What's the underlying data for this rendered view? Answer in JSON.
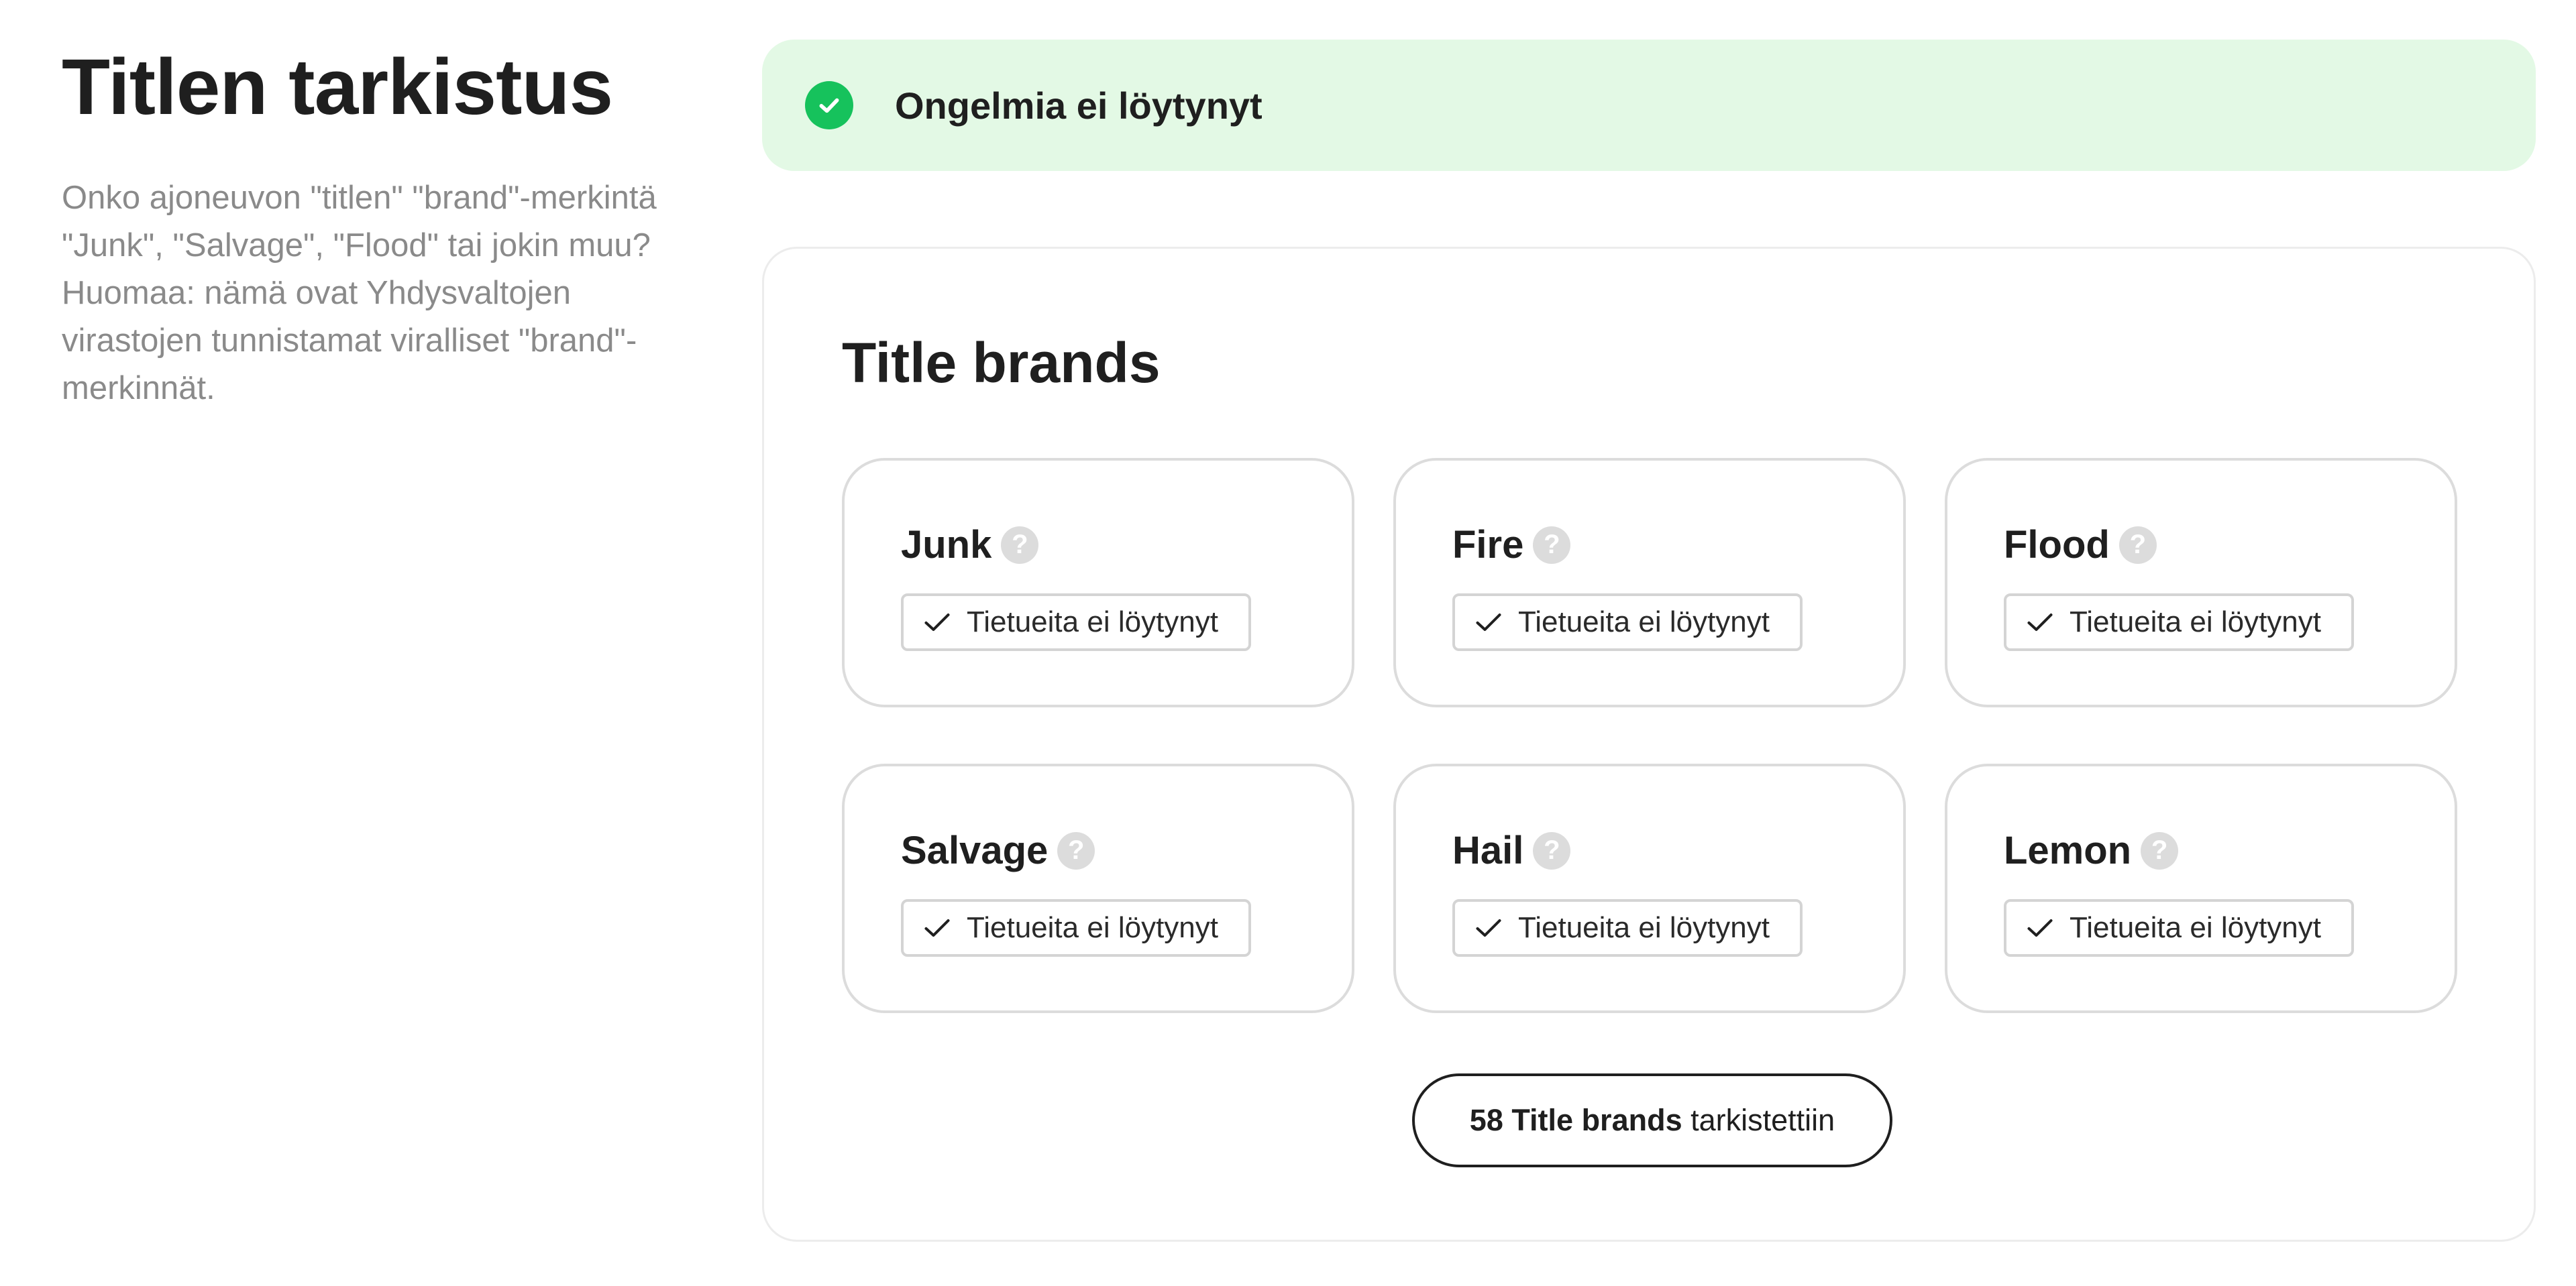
{
  "intro": {
    "title": "Titlen tarkistus",
    "description": "Onko ajoneuvon \"titlen\" \"brand\"-merkintä \"Junk\", \"Salvage\", \"Flood\" tai jokin muu? Huomaa: nämä ovat Yhdysvaltojen virastojen tunnistamat viralliset \"brand\"-merkinnät."
  },
  "banner": {
    "text": "Ongelmia ei löytynyt",
    "icon": "check-circle-icon",
    "color": "#16c25c",
    "background": "#e3f9e5"
  },
  "card": {
    "title": "Title brands",
    "brands": [
      {
        "name": "Junk",
        "status": "Tietueita ei löytynyt"
      },
      {
        "name": "Fire",
        "status": "Tietueita ei löytynyt"
      },
      {
        "name": "Flood",
        "status": "Tietueita ei löytynyt"
      },
      {
        "name": "Salvage",
        "status": "Tietueita ei löytynyt"
      },
      {
        "name": "Hail",
        "status": "Tietueita ei löytynyt"
      },
      {
        "name": "Lemon",
        "status": "Tietueita ei löytynyt"
      }
    ],
    "help_icon_glyph": "?",
    "summary": {
      "count": "58",
      "label": "Title brands",
      "suffix": "tarkistettiin"
    }
  }
}
